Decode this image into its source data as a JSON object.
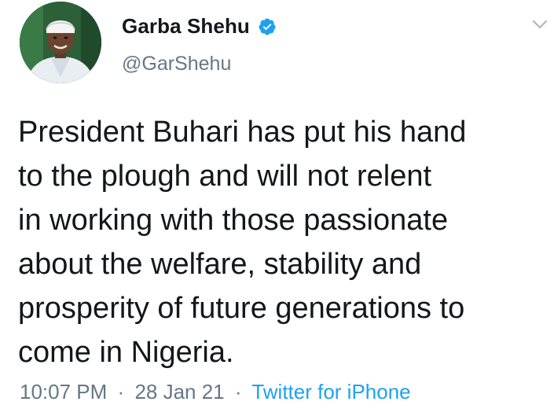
{
  "user": {
    "display_name": "Garba Shehu",
    "handle": "@GarShehu",
    "verified_icon": "verified-badge-icon",
    "avatar_icon": "profile-photo"
  },
  "menu_icon": "chevron-down-icon",
  "tweet": {
    "lines": [
      "President Buhari has put his hand",
      "to the plough and will not relent",
      "in working with those passionate",
      "about the welfare, stability and",
      "prosperity of future generations to",
      "come in Nigeria."
    ]
  },
  "meta": {
    "time": "10:07 PM",
    "separator": "·",
    "date": "28 Jan 21",
    "source": "Twitter for iPhone"
  },
  "colors": {
    "text": "#14171a",
    "secondary": "#657786",
    "accent": "#1da1f2"
  }
}
